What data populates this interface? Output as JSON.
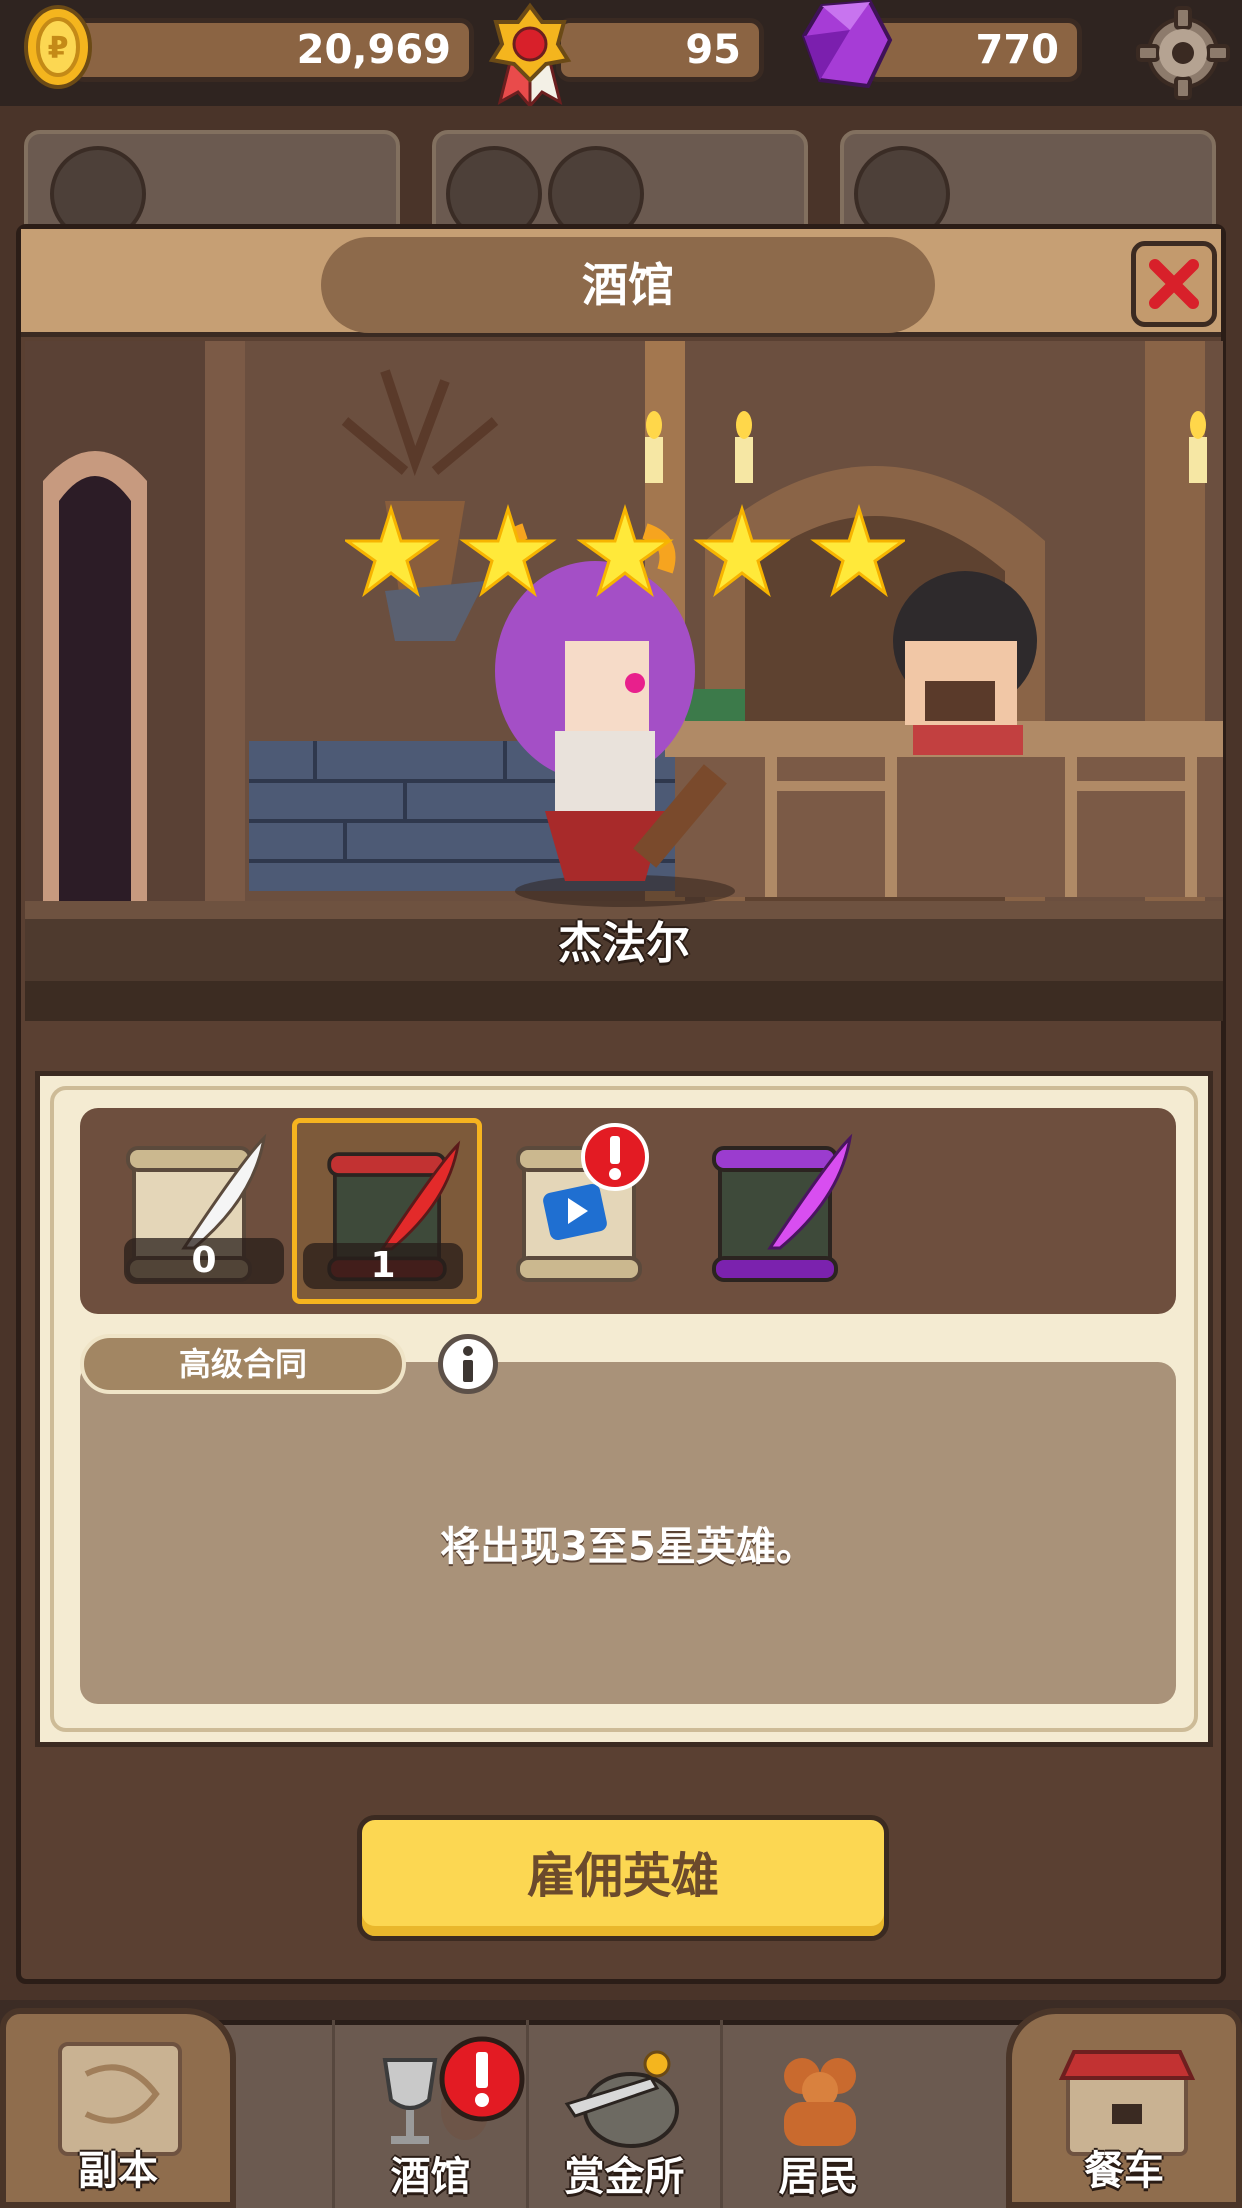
{
  "currency": {
    "gold": "20,969",
    "medal": "95",
    "gem": "770",
    "icons": [
      "gold-coin-icon",
      "medal-icon",
      "purple-gem-icon",
      "gear-icon"
    ]
  },
  "modal": {
    "title": "酒馆",
    "star_rating": 5,
    "hero_name": "杰法尔"
  },
  "contracts": {
    "slots": [
      {
        "icon": "white-quill-scroll-icon",
        "count": "0"
      },
      {
        "icon": "red-quill-scroll-icon",
        "count": "1",
        "selected": true
      },
      {
        "icon": "video-ad-scroll-icon",
        "alert": true
      },
      {
        "icon": "purple-quill-scroll-icon"
      }
    ],
    "selected_label": "高级合同",
    "description": "将出现3至5星英雄。"
  },
  "hire_button": "雇佣英雄",
  "nav": {
    "dungeon": "副本",
    "tavern": "酒馆",
    "bounty": "赏金所",
    "residents": "居民",
    "dining_car": "餐车"
  },
  "colors": {
    "accent_yellow": "#fcd752",
    "selected_border": "#f6b41f",
    "alert_red": "#e31b23",
    "star_yellow": "#ffe93a"
  }
}
